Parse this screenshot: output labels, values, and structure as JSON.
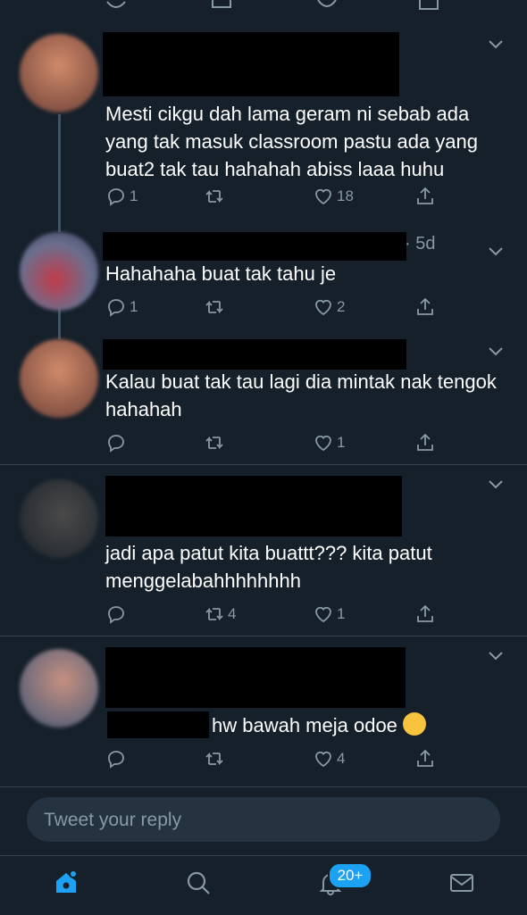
{
  "tweets": [
    {
      "text": "Mesti cikgu dah lama geram ni sebab ada yang tak masuk classroom pastu ada yang buat2 tak tau hahahah abiss laaa huhu",
      "replies": "1",
      "retweets": "",
      "likes": "18"
    },
    {
      "time": "· 5d",
      "text": "Hahahaha buat tak tahu je",
      "replies": "1",
      "retweets": "",
      "likes": "2"
    },
    {
      "text": "Kalau buat tak tau lagi dia mintak nak tengok hahahah",
      "replies": "",
      "retweets": "",
      "likes": "1"
    },
    {
      "text": "jadi apa patut kita buattt??? kita patut menggelabahhhhhhhh",
      "replies": "",
      "retweets": "4",
      "likes": "1"
    },
    {
      "text": "hw bawah meja odoe",
      "replies": "",
      "retweets": "",
      "likes": "4"
    }
  ],
  "composer": {
    "placeholder": "Tweet your reply"
  },
  "tabbar": {
    "notifications_badge": "20+"
  },
  "colors": {
    "background": "#15202b",
    "accent": "#1da1f2",
    "muted": "#8899a6"
  }
}
